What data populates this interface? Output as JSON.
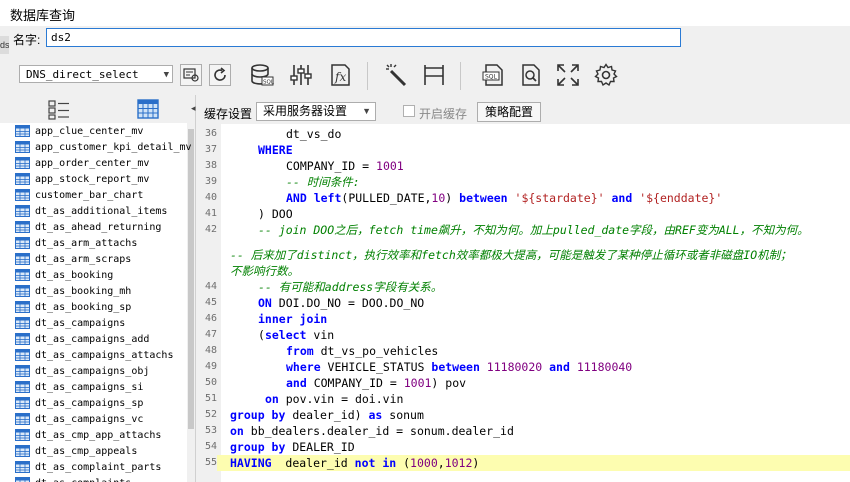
{
  "window": {
    "title": "数据库查询",
    "left_tab_text": "ds"
  },
  "search": {
    "label": "名字:",
    "value": "ds2"
  },
  "toolbar": {
    "datasource": "DNS_direct_select",
    "icons": [
      "datasource-edit-icon",
      "refresh-icon",
      "database-sql-icon",
      "sliders-icon",
      "function-icon",
      "magic-wand-icon",
      "column-split-icon",
      "sql-file-icon",
      "search-document-icon",
      "expand-icon",
      "gear-icon"
    ]
  },
  "sidebar": {
    "items": [
      "app_clue_center_mv",
      "app_customer_kpi_detail_mv",
      "app_order_center_mv",
      "app_stock_report_mv",
      "customer_bar_chart",
      "dt_as_additional_items",
      "dt_as_ahead_returning",
      "dt_as_arm_attachs",
      "dt_as_arm_scraps",
      "dt_as_booking",
      "dt_as_booking_mh",
      "dt_as_booking_sp",
      "dt_as_campaigns",
      "dt_as_campaigns_add",
      "dt_as_campaigns_attachs",
      "dt_as_campaigns_obj",
      "dt_as_campaigns_si",
      "dt_as_campaigns_sp",
      "dt_as_campaigns_vc",
      "dt_as_cmp_app_attachs",
      "dt_as_cmp_appeals",
      "dt_as_complaint_parts",
      "dt_as_complaints"
    ]
  },
  "cache": {
    "label": "缓存设置",
    "mode": "采用服务器设置",
    "enable_label": "开启缓存",
    "strategy_button": "策略配置"
  },
  "editor": {
    "lines": [
      {
        "n": "36",
        "indent": 2,
        "tokens": [
          [
            "plain",
            "dt_vs_do"
          ]
        ]
      },
      {
        "n": "37",
        "indent": 1,
        "tokens": [
          [
            "kw",
            "WHERE"
          ]
        ]
      },
      {
        "n": "38",
        "indent": 2,
        "tokens": [
          [
            "plain",
            "COMPANY_ID = "
          ],
          [
            "num",
            "1001"
          ]
        ]
      },
      {
        "n": "39",
        "indent": 2,
        "tokens": [
          [
            "cm",
            "-- 时间条件:"
          ]
        ]
      },
      {
        "n": "40",
        "indent": 2,
        "tokens": [
          [
            "kw",
            "AND "
          ],
          [
            "kw",
            "left"
          ],
          [
            "plain",
            "(PULLED_DATE,"
          ],
          [
            "num",
            "10"
          ],
          [
            "plain",
            ") "
          ],
          [
            "kw",
            "between "
          ],
          [
            "str",
            "'${stardate}'"
          ],
          [
            "plain",
            " "
          ],
          [
            "kw",
            "and "
          ],
          [
            "str",
            "'${enddate}'"
          ]
        ]
      },
      {
        "n": "41",
        "indent": 1,
        "tokens": [
          [
            "plain",
            ") DOO"
          ]
        ]
      },
      {
        "n": "42",
        "indent": 1,
        "tokens": [
          [
            "cm",
            "-- join DOO之后，fetch time飙升，不知为何。加上pulled_date字段，由REF变为ALL，不知为何。"
          ]
        ]
      },
      {
        "n": "",
        "indent": 0,
        "tokens": [
          [
            "cm",
            "-- 后来加了distinct，执行效率和fetch效率都极大提高，可能是触发了某种停止循环或者非磁盘IO机制；"
          ]
        ]
      },
      {
        "n": "",
        "indent": 0,
        "tokens": [
          [
            "cm",
            "不影响行数。"
          ]
        ]
      },
      {
        "n": "44",
        "indent": 1,
        "tokens": [
          [
            "cm",
            "-- 有可能和address字段有关系。"
          ]
        ]
      },
      {
        "n": "45",
        "indent": 1,
        "tokens": [
          [
            "kw",
            "ON "
          ],
          [
            "plain",
            "DOI.DO_NO = DOO.DO_NO"
          ]
        ]
      },
      {
        "n": "46",
        "indent": 1,
        "tokens": [
          [
            "kw",
            "inner join"
          ]
        ]
      },
      {
        "n": "47",
        "indent": 1,
        "tokens": [
          [
            "plain",
            "("
          ],
          [
            "kw",
            "select "
          ],
          [
            "plain",
            "vin"
          ]
        ]
      },
      {
        "n": "48",
        "indent": 2,
        "tokens": [
          [
            "kw",
            "from "
          ],
          [
            "plain",
            "dt_vs_po_vehicles"
          ]
        ]
      },
      {
        "n": "49",
        "indent": 2,
        "tokens": [
          [
            "kw",
            "where "
          ],
          [
            "plain",
            "VEHICLE_STATUS "
          ],
          [
            "kw",
            "between "
          ],
          [
            "num",
            "11180020"
          ],
          [
            "plain",
            " "
          ],
          [
            "kw",
            "and "
          ],
          [
            "num",
            "11180040"
          ]
        ]
      },
      {
        "n": "50",
        "indent": 2,
        "tokens": [
          [
            "kw",
            "and "
          ],
          [
            "plain",
            "COMPANY_ID = "
          ],
          [
            "num",
            "1001"
          ],
          [
            "plain",
            ") pov"
          ]
        ]
      },
      {
        "n": "51",
        "indent": 1,
        "tokens": [
          [
            "plain",
            " "
          ],
          [
            "kw",
            "on "
          ],
          [
            "plain",
            "pov.vin = doi.vin"
          ]
        ]
      },
      {
        "n": "52",
        "indent": 0,
        "tokens": [
          [
            "kw",
            "group by "
          ],
          [
            "plain",
            "dealer_id) "
          ],
          [
            "kw",
            "as "
          ],
          [
            "plain",
            "sonum"
          ]
        ]
      },
      {
        "n": "53",
        "indent": 0,
        "tokens": [
          [
            "kw",
            "on "
          ],
          [
            "plain",
            "bb_dealers.dealer_id = sonum.dealer_id"
          ]
        ]
      },
      {
        "n": "54",
        "indent": 0,
        "tokens": [
          [
            "kw",
            "group by "
          ],
          [
            "plain",
            "DEALER_ID"
          ]
        ]
      },
      {
        "n": "55",
        "indent": 0,
        "highlight": true,
        "tokens": [
          [
            "kw",
            "HAVING  "
          ],
          [
            "plain",
            "dealer_id "
          ],
          [
            "kw",
            "not in "
          ],
          [
            "plain",
            "("
          ],
          [
            "num",
            "1000"
          ],
          [
            "plain",
            ","
          ],
          [
            "num",
            "1012"
          ],
          [
            "plain",
            ")"
          ]
        ]
      }
    ]
  }
}
